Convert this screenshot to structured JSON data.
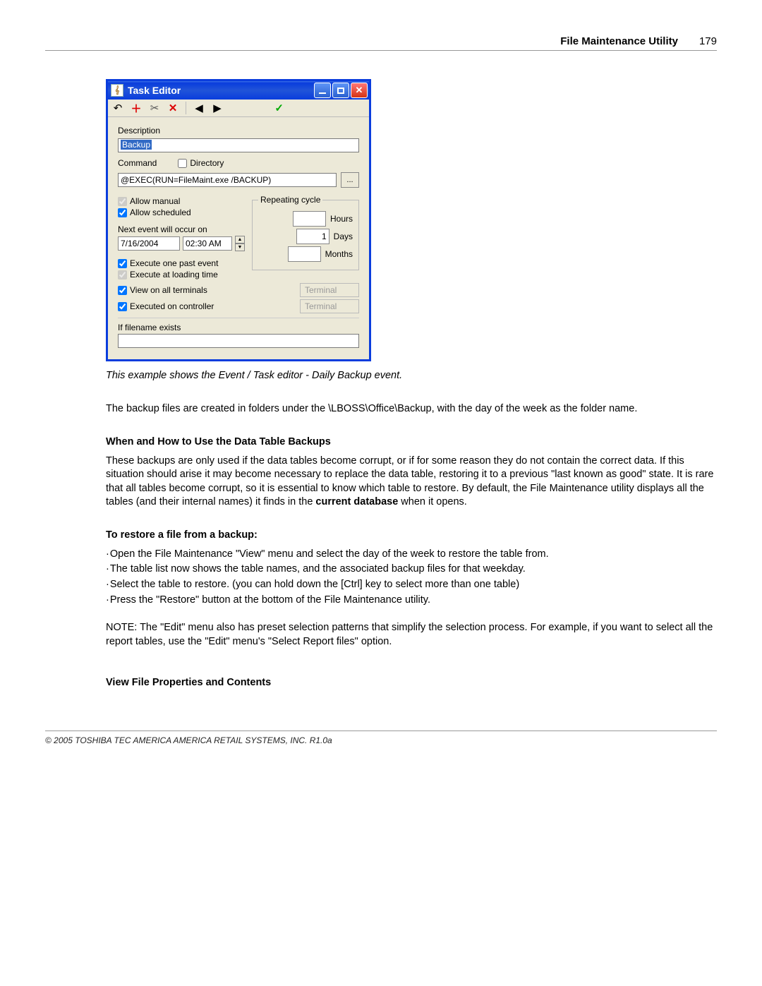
{
  "header": {
    "title": "File Maintenance Utility",
    "page": "179"
  },
  "window": {
    "title": "Task Editor",
    "toolbar_icons": [
      "undo",
      "add",
      "cut",
      "delete",
      "prev",
      "next",
      "check"
    ],
    "labels": {
      "description": "Description",
      "command": "Command",
      "directory": "Directory",
      "allow_manual": "Allow manual",
      "allow_scheduled": "Allow scheduled",
      "next_event": "Next event will occur on",
      "repeating_cycle": "Repeating cycle",
      "hours": "Hours",
      "days": "Days",
      "months": "Months",
      "exec_one_past": "Execute one past event",
      "exec_loading": "Execute at loading time",
      "view_all_term": "View on all terminals",
      "exec_controller": "Executed on controller",
      "terminal": "Terminal",
      "if_filename": "If filename exists"
    },
    "values": {
      "description": "Backup",
      "command": "@EXEC(RUN=FileMaint.exe /BACKUP)",
      "date": "7/16/2004",
      "time": "02:30 AM",
      "ellipsis": "...",
      "days": "1"
    },
    "checks": {
      "directory": false,
      "allow_manual": true,
      "allow_scheduled": true,
      "exec_one_past": true,
      "exec_loading": true,
      "view_all_term": true,
      "exec_controller": true
    }
  },
  "caption": "This example shows the Event / Task editor - Daily Backup event.",
  "para1": " The backup files are created in folders under the \\LBOSS\\Office\\Backup, with the day of the week as the folder name.",
  "sect1_head": "When and How to Use the Data Table Backups",
  "sect1_body_a": " These backups are only used if the data tables become corrupt, or if for some reason they do not contain the correct data. If this situation should arise it may become necessary to replace the data table, restoring it to a previous \"last known as good\" state. It is rare that all tables become corrupt, so it is essential to know which table to restore. By default, the File Maintenance utility displays all the tables (and their internal names) it finds in the ",
  "sect1_body_bold": "current database",
  "sect1_body_b": " when it opens.",
  "sect2_head": "To restore a file from a backup:",
  "bullets": [
    "Open the File Maintenance \"View\" menu and select the day of the week to restore the table from.",
    "The table list now shows the table names, and the associated backup files for that weekday.",
    "Select the table to restore. (you can hold down the [Ctrl] key to select more than one table)",
    "Press the \"Restore\" button at the bottom of the File Maintenance utility."
  ],
  "note": "NOTE: The \"Edit\" menu also has preset selection patterns that simplify the selection process. For example, if you want to select all the report tables, use the \"Edit\" menu's \"Select Report files\" option.",
  "sect3_head": "View File Properties and Contents",
  "footer": "© 2005 TOSHIBA TEC AMERICA AMERICA RETAIL SYSTEMS, INC.   R1.0a"
}
